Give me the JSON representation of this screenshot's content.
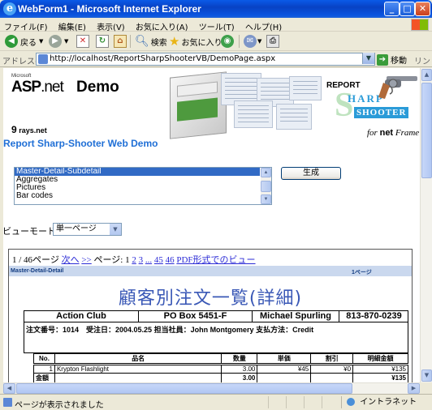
{
  "window": {
    "title": "WebForm1 - Microsoft Internet Explorer",
    "min_glyph": "_",
    "max_glyph": "□",
    "close_glyph": "✕"
  },
  "menu": [
    "ファイル(F)",
    "編集(E)",
    "表示(V)",
    "お気に入り(A)",
    "ツール(T)",
    "ヘルプ(H)"
  ],
  "toolbar": {
    "back_label": "戻る",
    "search_label": "検索",
    "favorites_label": "お気に入り"
  },
  "address": {
    "label": "アドレス(D)",
    "url": "http://localhost/ReportSharpShooterVB/DemoPage.aspx",
    "go_label": "移動",
    "links_label": "リンク"
  },
  "banner": {
    "ms_label": "Microsoft",
    "aspnet_asp": "ASP",
    "aspnet_net": ".net",
    "demo_label": "Demo",
    "report_label": "REPORT",
    "sharp_label": "HARP",
    "shooter_label": "SHOOTER",
    "for_label": "for",
    "net_label": "net",
    "frame_label": "Frame",
    "rays_label": "rays.net"
  },
  "page": {
    "heading": "Report Sharp-Shooter Web Demo"
  },
  "report_list": {
    "options": [
      "Master-Detail-Subdetail",
      "Aggregates",
      "Pictures",
      "Bar codes"
    ],
    "selected_index": 0
  },
  "generate_button": "生成",
  "view_mode": {
    "label": "ビューモード",
    "selected": "単一ページ"
  },
  "pager": {
    "position": "1 / 46ページ",
    "next": "次へ",
    "next_more": ">>",
    "pages_label": "ページ:",
    "current": "1",
    "page_2": "2",
    "page_3": "3",
    "ellipsis": "...",
    "page_45": "45",
    "page_46": "46",
    "pdf_link": "PDF形式でのビュー"
  },
  "report": {
    "band_title": "Master-Detail-Detail",
    "page_label": "1ページ",
    "title": "顧客別注文一覧(詳細)",
    "customer": {
      "name": "Action Club",
      "address": "PO Box 5451-F",
      "contact": "Michael Spurling",
      "phone": "813-870-0239"
    },
    "order_line": "注文番号：1014　受注日：2004.05.25 担当社員：John Montgomery 支払方法：Credit",
    "columns": [
      "No.",
      "品名",
      "数量",
      "単価",
      "割引",
      "明細金額"
    ],
    "rows": [
      {
        "no": "1",
        "name": "Krypton Flashlight",
        "qty": "3.00",
        "price": "¥45",
        "discount": "¥0",
        "amount": "¥135"
      }
    ],
    "total": {
      "label": "金額",
      "qty": "3.00",
      "amount": "¥135"
    }
  },
  "status": {
    "text": "ページが表示されました",
    "zone": "イントラネット"
  },
  "colors": {
    "titlebar": "#0842c4",
    "heading": "#1f6fd6",
    "report_title": "#3a58b6",
    "band": "#cad8ee",
    "selection": "#316ac5"
  }
}
